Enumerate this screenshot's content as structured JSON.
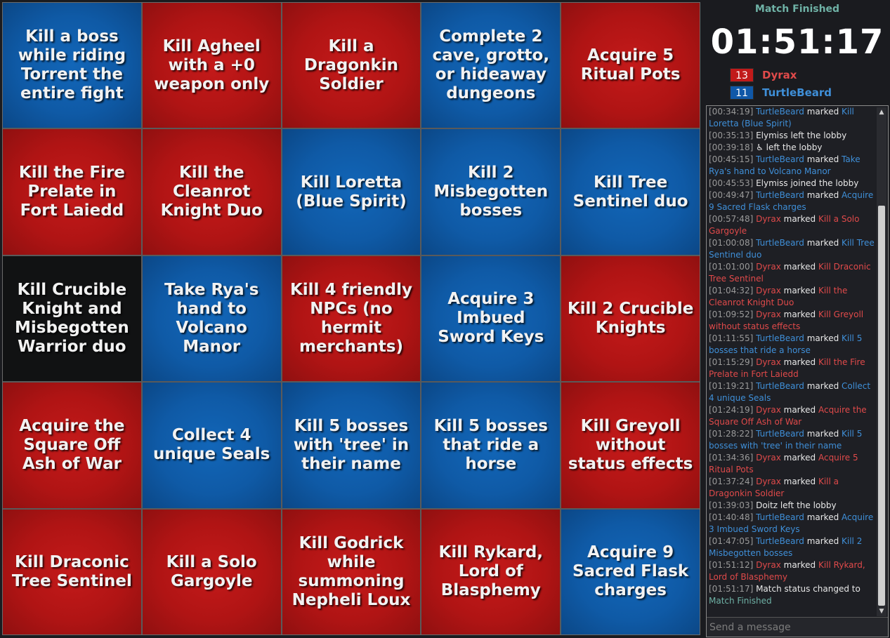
{
  "colors": {
    "red": "#b01414",
    "blue": "#0f5aa6",
    "black": "#111213",
    "accent_teal": "#6fb2a6",
    "team_red_text": "#e04a4a",
    "team_blue_text": "#3f8fd8"
  },
  "board": {
    "cells": [
      {
        "text": "Kill a boss while riding Torrent the entire fight",
        "color": "blue"
      },
      {
        "text": "Kill Agheel with a +0 weapon only",
        "color": "red"
      },
      {
        "text": "Kill a Dragonkin Soldier",
        "color": "red"
      },
      {
        "text": "Complete 2 cave, grotto, or hideaway dungeons",
        "color": "blue"
      },
      {
        "text": "Acquire 5 Ritual Pots",
        "color": "red"
      },
      {
        "text": "Kill the Fire Prelate in Fort Laiedd",
        "color": "red"
      },
      {
        "text": "Kill the Cleanrot Knight Duo",
        "color": "red"
      },
      {
        "text": "Kill Loretta (Blue Spirit)",
        "color": "blue"
      },
      {
        "text": "Kill 2 Misbegotten bosses",
        "color": "blue"
      },
      {
        "text": "Kill Tree Sentinel duo",
        "color": "blue"
      },
      {
        "text": "Kill Crucible Knight and Misbegotten Warrior duo",
        "color": "black"
      },
      {
        "text": "Take Rya's hand to Volcano Manor",
        "color": "blue"
      },
      {
        "text": "Kill 4 friendly NPCs (no hermit merchants)",
        "color": "red"
      },
      {
        "text": "Acquire 3 Imbued Sword Keys",
        "color": "blue"
      },
      {
        "text": "Kill 2 Crucible Knights",
        "color": "red"
      },
      {
        "text": "Acquire the Square Off Ash of War",
        "color": "red"
      },
      {
        "text": "Collect 4 unique Seals",
        "color": "blue"
      },
      {
        "text": "Kill 5 bosses with 'tree' in their name",
        "color": "blue"
      },
      {
        "text": "Kill 5 bosses that ride a horse",
        "color": "blue"
      },
      {
        "text": "Kill Greyoll without status effects",
        "color": "red"
      },
      {
        "text": "Kill Draconic Tree Sentinel",
        "color": "red"
      },
      {
        "text": "Kill a Solo Gargoyle",
        "color": "red"
      },
      {
        "text": "Kill Godrick while summoning Nepheli Loux",
        "color": "red"
      },
      {
        "text": "Kill Rykard, Lord of Blasphemy",
        "color": "red"
      },
      {
        "text": "Acquire 9 Sacred Flask charges",
        "color": "blue"
      }
    ]
  },
  "sidebar": {
    "status": "Match Finished",
    "timer": "01:51:17",
    "teams": [
      {
        "score": "13",
        "name": "Dyrax",
        "color": "red"
      },
      {
        "score": "11",
        "name": "TurtleBeard",
        "color": "blue"
      }
    ],
    "chat_placeholder": "Send a message",
    "log": [
      {
        "time": "[00:34:19]",
        "player": "TurtleBeard",
        "pcolor": "blue",
        "text": " marked ",
        "goal": "Kill Loretta (Blue Spirit)",
        "gcolor": "blue"
      },
      {
        "time": "[00:35:13]",
        "text": " Elymiss left the lobby"
      },
      {
        "time": "[00:39:18]",
        "text": " ♿ left the lobby"
      },
      {
        "time": "[00:45:15]",
        "player": "TurtleBeard",
        "pcolor": "blue",
        "text": " marked ",
        "goal": "Take Rya's hand to Volcano Manor",
        "gcolor": "blue"
      },
      {
        "time": "[00:45:53]",
        "text": " Elymiss joined the lobby"
      },
      {
        "time": "[00:49:47]",
        "player": "TurtleBeard",
        "pcolor": "blue",
        "text": " marked ",
        "goal": "Acquire 9 Sacred Flask charges",
        "gcolor": "blue"
      },
      {
        "time": "[00:57:48]",
        "player": "Dyrax",
        "pcolor": "red",
        "text": " marked ",
        "goal": "Kill a Solo Gargoyle",
        "gcolor": "red"
      },
      {
        "time": "[01:00:08]",
        "player": "TurtleBeard",
        "pcolor": "blue",
        "text": " marked ",
        "goal": "Kill Tree Sentinel duo",
        "gcolor": "blue"
      },
      {
        "time": "[01:01:00]",
        "player": "Dyrax",
        "pcolor": "red",
        "text": " marked ",
        "goal": "Kill Draconic Tree Sentinel",
        "gcolor": "red"
      },
      {
        "time": "[01:04:32]",
        "player": "Dyrax",
        "pcolor": "red",
        "text": " marked ",
        "goal": "Kill the Cleanrot Knight Duo",
        "gcolor": "red"
      },
      {
        "time": "[01:09:52]",
        "player": "Dyrax",
        "pcolor": "red",
        "text": " marked ",
        "goal": "Kill Greyoll without status effects",
        "gcolor": "red"
      },
      {
        "time": "[01:11:55]",
        "player": "TurtleBeard",
        "pcolor": "blue",
        "text": " marked ",
        "goal": "Kill 5 bosses that ride a horse",
        "gcolor": "blue"
      },
      {
        "time": "[01:15:29]",
        "player": "Dyrax",
        "pcolor": "red",
        "text": " marked ",
        "goal": "Kill the Fire Prelate in Fort Laiedd",
        "gcolor": "red"
      },
      {
        "time": "[01:19:21]",
        "player": "TurtleBeard",
        "pcolor": "blue",
        "text": " marked ",
        "goal": "Collect 4 unique Seals",
        "gcolor": "blue"
      },
      {
        "time": "[01:24:19]",
        "player": "Dyrax",
        "pcolor": "red",
        "text": " marked ",
        "goal": "Acquire the Square Off Ash of War",
        "gcolor": "red"
      },
      {
        "time": "[01:28:22]",
        "player": "TurtleBeard",
        "pcolor": "blue",
        "text": " marked ",
        "goal": "Kill 5 bosses with 'tree' in their name",
        "gcolor": "blue"
      },
      {
        "time": "[01:34:36]",
        "player": "Dyrax",
        "pcolor": "red",
        "text": " marked ",
        "goal": "Acquire 5 Ritual Pots",
        "gcolor": "red"
      },
      {
        "time": "[01:37:24]",
        "player": "Dyrax",
        "pcolor": "red",
        "text": " marked ",
        "goal": "Kill a Dragonkin Soldier",
        "gcolor": "red"
      },
      {
        "time": "[01:39:03]",
        "text": " Doitz left the lobby"
      },
      {
        "time": "[01:40:48]",
        "player": "TurtleBeard",
        "pcolor": "blue",
        "text": " marked ",
        "goal": "Acquire 3 Imbued Sword Keys",
        "gcolor": "blue"
      },
      {
        "time": "[01:47:05]",
        "player": "TurtleBeard",
        "pcolor": "blue",
        "text": " marked ",
        "goal": "Kill 2 Misbegotten bosses",
        "gcolor": "blue"
      },
      {
        "time": "[01:51:12]",
        "player": "Dyrax",
        "pcolor": "red",
        "text": " marked ",
        "goal": "Kill Rykard, Lord of Blasphemy",
        "gcolor": "red"
      },
      {
        "time": "[01:51:17]",
        "text": " Match status changed to ",
        "goal": "Match Finished",
        "gcolor": "green"
      }
    ]
  }
}
